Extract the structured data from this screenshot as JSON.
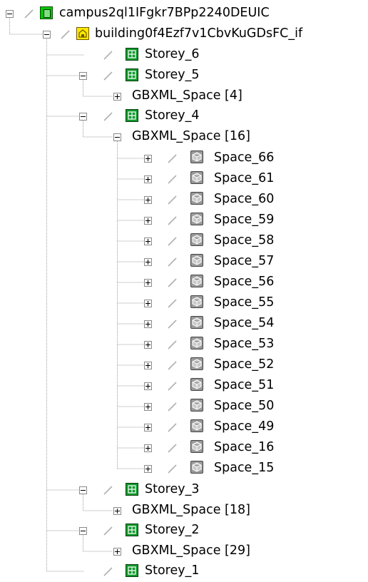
{
  "tree": {
    "campus": {
      "label": "campus2ql1IFgkr7BPp2240DEUIC",
      "icon": "campus-icon"
    },
    "building": {
      "label": "building0f4Ezf7v1CbvKuGDsFC_if",
      "icon": "building-icon"
    },
    "storeys": [
      {
        "label": "Storey_6",
        "icon": "storey-icon"
      },
      {
        "label": "Storey_5",
        "icon": "storey-icon",
        "space_group": "GBXML_Space [4]"
      },
      {
        "label": "Storey_4",
        "icon": "storey-icon",
        "space_group": "GBXML_Space [16]"
      },
      {
        "label": "Storey_3",
        "icon": "storey-icon",
        "space_group": "GBXML_Space [18]"
      },
      {
        "label": "Storey_2",
        "icon": "storey-icon",
        "space_group": "GBXML_Space [29]"
      },
      {
        "label": "Storey_1",
        "icon": "storey-icon"
      }
    ],
    "spaces": [
      "Space_66",
      "Space_61",
      "Space_60",
      "Space_59",
      "Space_58",
      "Space_57",
      "Space_56",
      "Space_55",
      "Space_54",
      "Space_53",
      "Space_52",
      "Space_51",
      "Space_50",
      "Space_49",
      "Space_16",
      "Space_15"
    ]
  },
  "colors": {
    "connector": "#a0a0a0",
    "campus_icon": "#00c800",
    "building_icon": "#ffe800",
    "storey_icon": "#0c9a2a",
    "space_icon": "#9a9a9a"
  }
}
